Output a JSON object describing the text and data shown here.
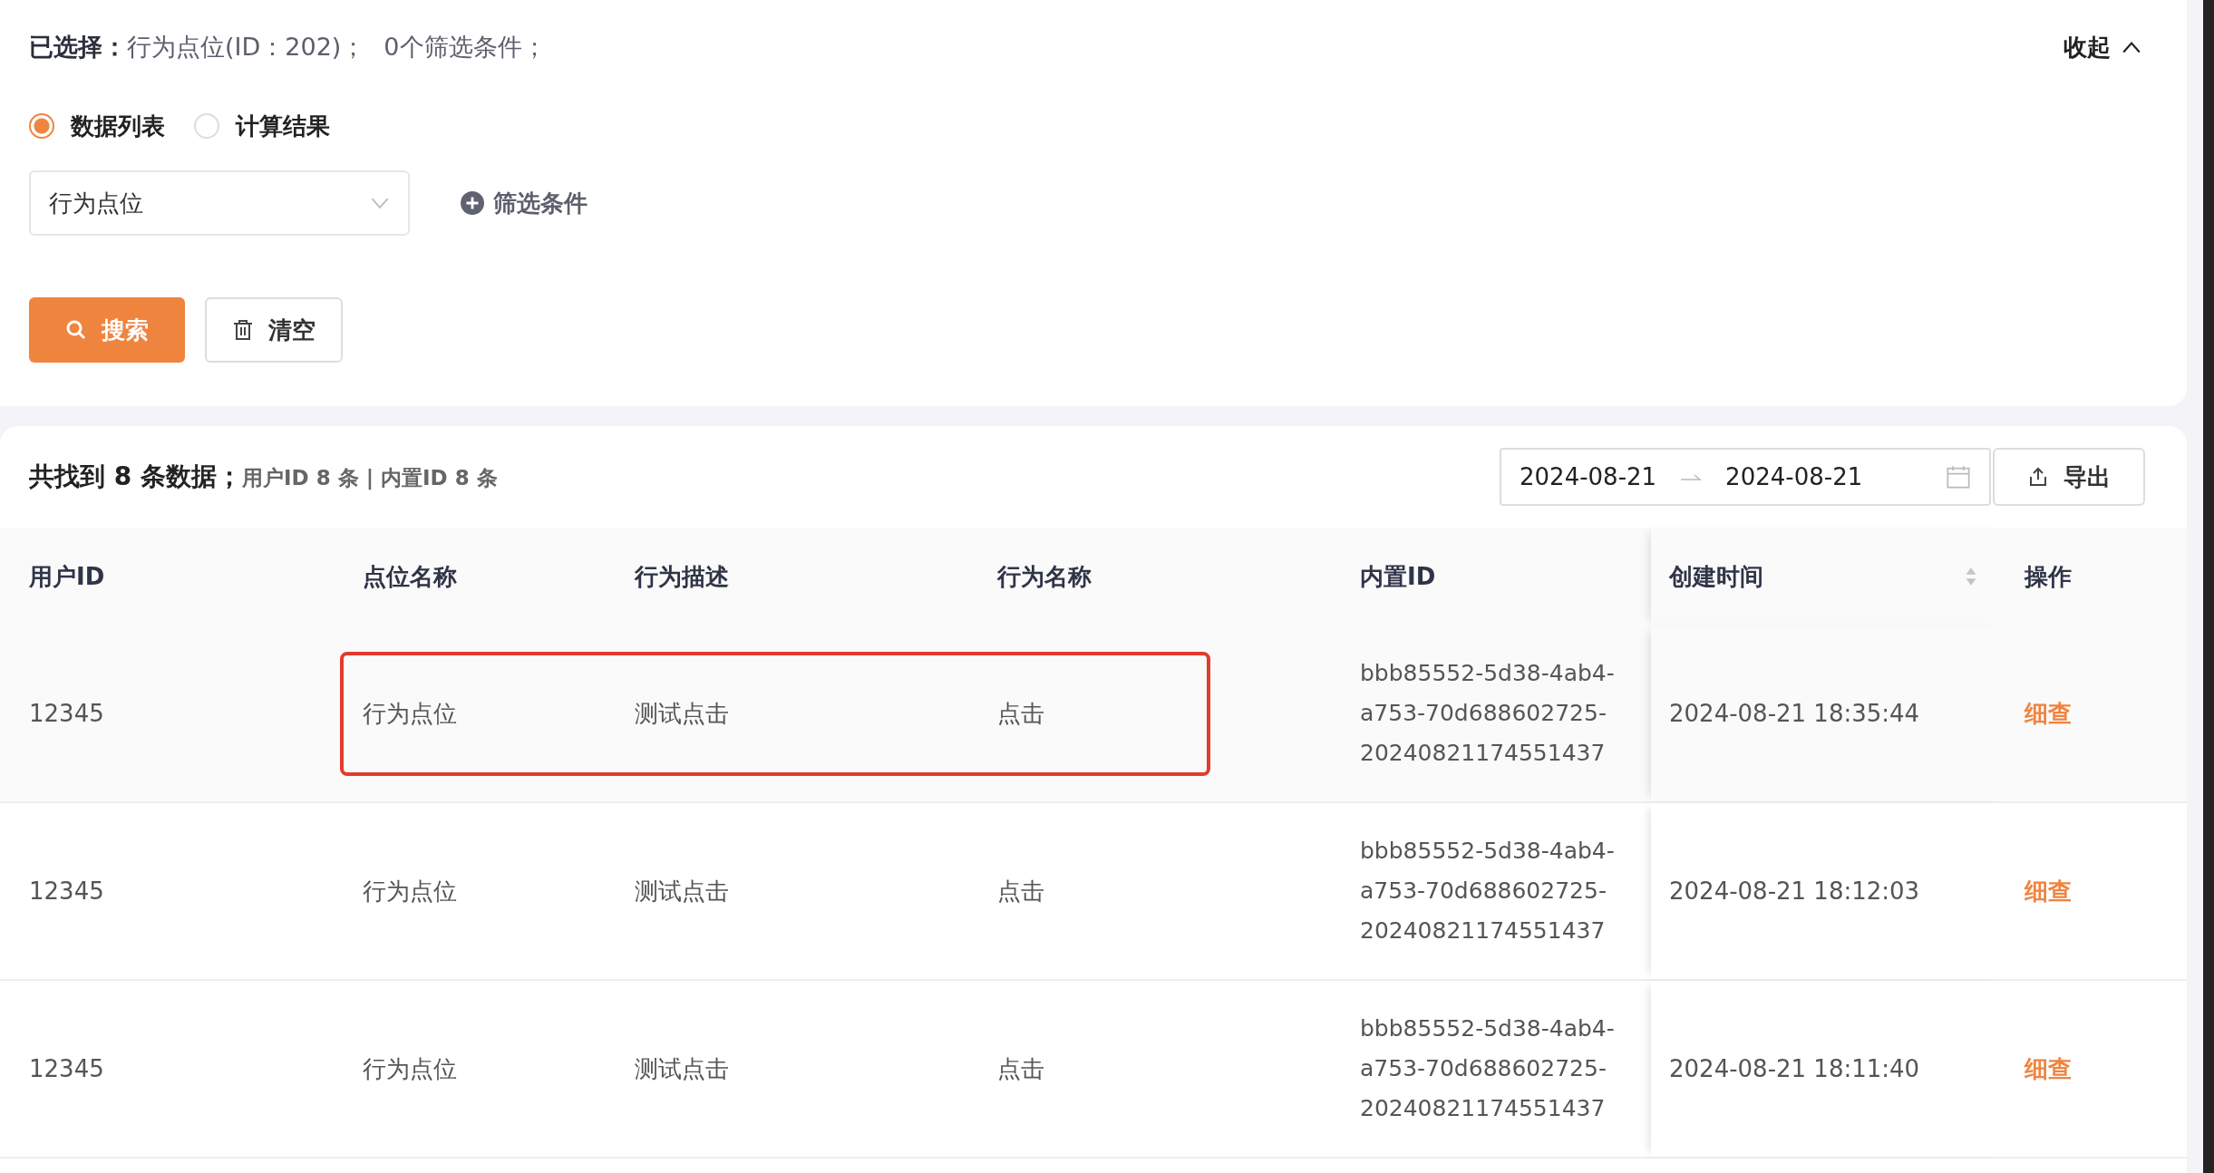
{
  "selection": {
    "label": "已选择：",
    "value": "行为点位(ID：202)；",
    "filters": "0个筛选条件；"
  },
  "collapse": {
    "label": "收起",
    "expanded": true
  },
  "views": [
    {
      "label": "数据列表",
      "selected": true
    },
    {
      "label": "计算结果",
      "selected": false
    }
  ],
  "select": {
    "value": "行为点位"
  },
  "add_filter": {
    "label": "筛选条件"
  },
  "buttons": [
    {
      "kind": "primary",
      "label": "搜索"
    },
    {
      "kind": "clear",
      "label": "清空"
    }
  ],
  "summary": {
    "title": "共找到 8 条数据；",
    "detail": "用户ID 8 条 | 内置ID 8 条"
  },
  "date_range": {
    "start": "2024-08-21",
    "end": "2024-08-21"
  },
  "export": {
    "label": "导出"
  },
  "table": {
    "columns": [
      "用户ID",
      "点位名称",
      "行为描述",
      "行为名称",
      "内置ID",
      "创建时间",
      "操作"
    ],
    "rows": [
      {
        "hovered": true,
        "highlighted": true,
        "cells": [
          "12345",
          "行为点位",
          "测试点击",
          "点击",
          "bbb85552-5d38-4ab4-a753-70d688602725-20240821174551437",
          "2024-08-21 18:35:44",
          "细查"
        ]
      },
      {
        "hovered": false,
        "highlighted": false,
        "cells": [
          "12345",
          "行为点位",
          "测试点击",
          "点击",
          "bbb85552-5d38-4ab4-a753-70d688602725-20240821174551437",
          "2024-08-21 18:12:03",
          "细查"
        ]
      },
      {
        "hovered": false,
        "highlighted": false,
        "cells": [
          "12345",
          "行为点位",
          "测试点击",
          "点击",
          "bbb85552-5d38-4ab4-a753-70d688602725-20240821174551437",
          "2024-08-21 18:11:40",
          "细查"
        ]
      }
    ]
  }
}
